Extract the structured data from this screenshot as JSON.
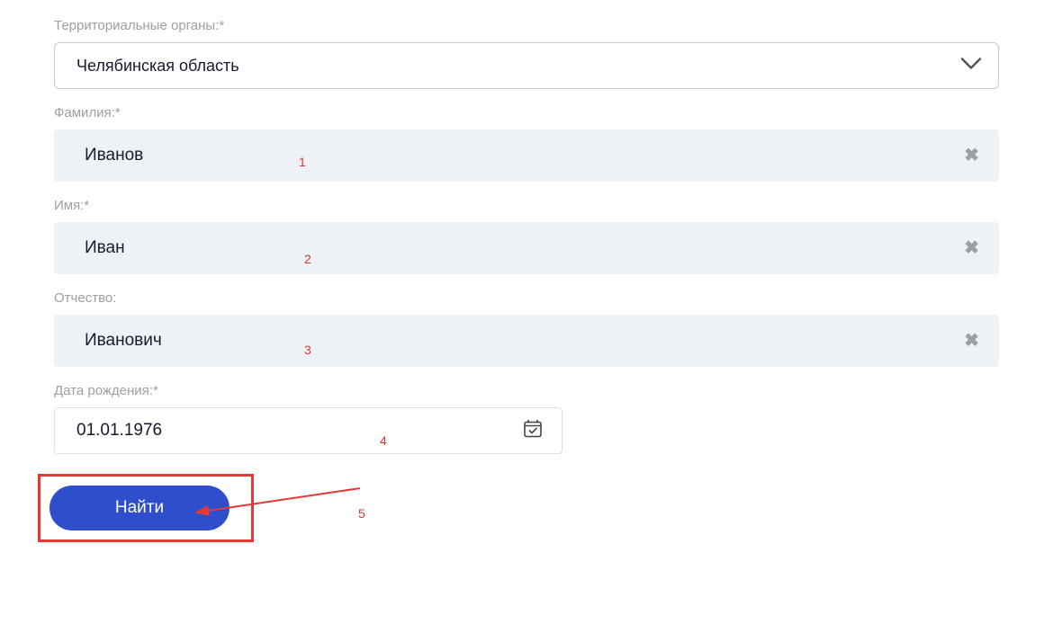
{
  "labels": {
    "territory": "Территориальные органы:*",
    "lastname": "Фамилия:*",
    "firstname": "Имя:*",
    "patronymic": "Отчество:",
    "dob": "Дата рождения:*"
  },
  "values": {
    "territory": "Челябинская область",
    "lastname": "Иванов",
    "firstname": "Иван",
    "patronymic": "Иванович",
    "dob": "01.01.1976"
  },
  "buttons": {
    "submit": "Найти"
  },
  "annotations": {
    "n1": "1",
    "n2": "2",
    "n3": "3",
    "n4": "4",
    "n5": "5"
  }
}
